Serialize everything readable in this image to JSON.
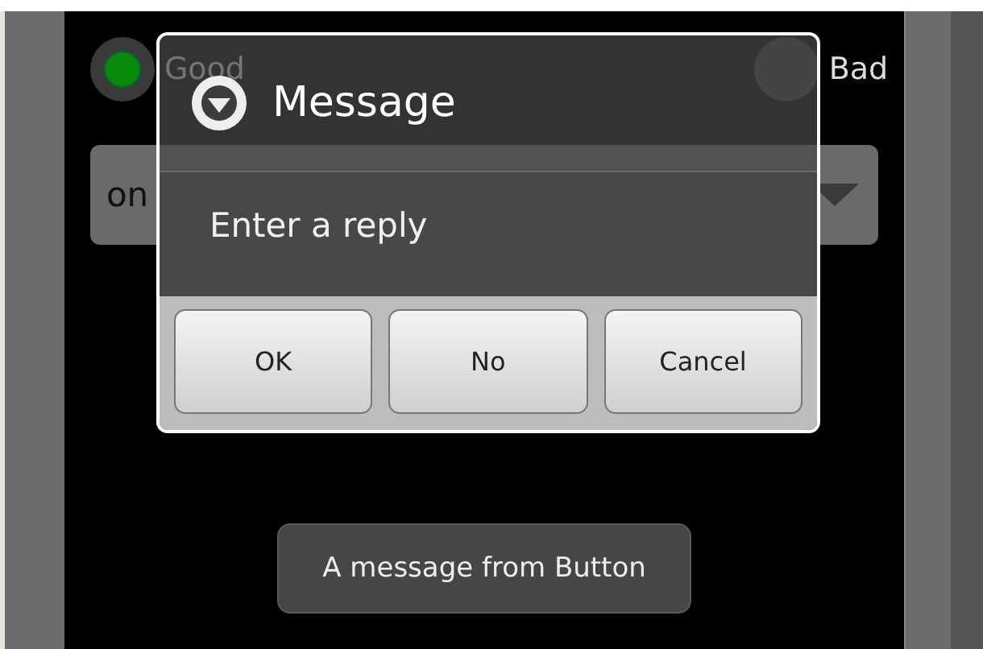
{
  "background": {
    "radios": [
      {
        "label": "Good",
        "selected": true
      },
      {
        "label": "Bad",
        "selected": false
      }
    ],
    "spinner": {
      "value": "on"
    }
  },
  "dialog": {
    "title": "Message",
    "message": "Enter a reply",
    "buttons": [
      "OK",
      "No",
      "Cancel"
    ]
  },
  "toast": "A message from Button"
}
